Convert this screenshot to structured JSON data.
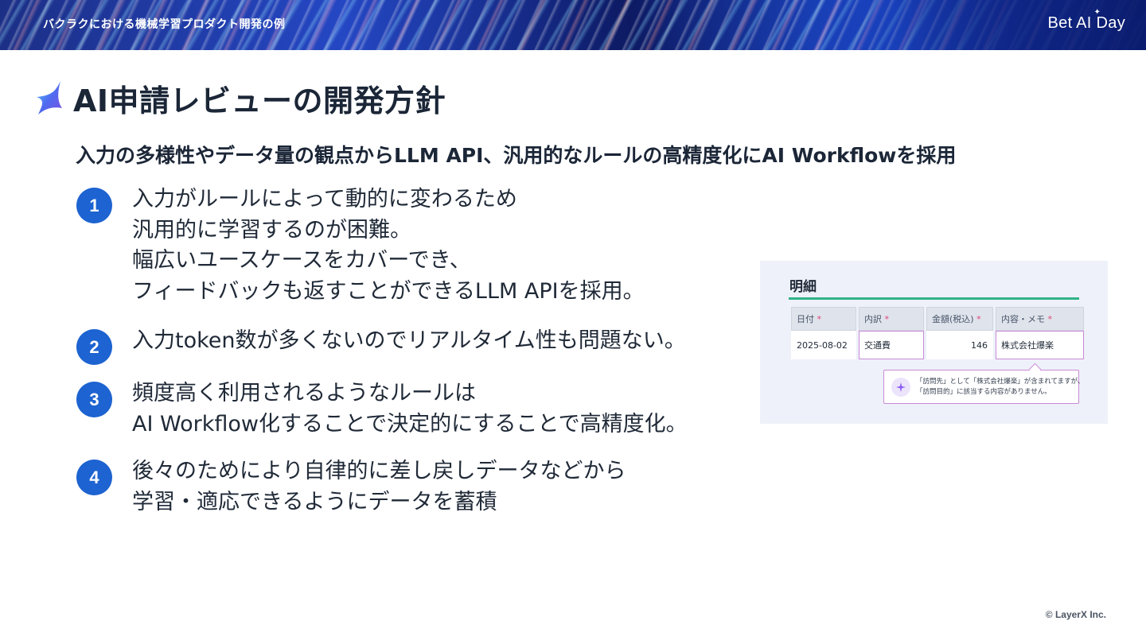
{
  "header": {
    "breadcrumb": "バクラクにおける機械学習プロダクト開発の例",
    "brand": "Bet AI Day"
  },
  "slide": {
    "title": "AI申請レビューの開発方針",
    "subtitle": "入力の多様性やデータ量の観点からLLM API、汎用的なルールの高精度化にAI Workflowを採用",
    "items": [
      {
        "number": "1",
        "lines": [
          "入力がルールによって動的に変わるため",
          "汎用的に学習するのが困難。",
          "幅広いユースケースをカバーでき、",
          "フィードバックも返すことができるLLM APIを採用。"
        ]
      },
      {
        "number": "2",
        "lines": [
          "入力token数が多くないのでリアルタイム性も問題ない。"
        ]
      },
      {
        "number": "3",
        "lines": [
          "頻度高く利用されるようなルールは",
          "AI Workflow化することで決定的にすることで高精度化。"
        ]
      },
      {
        "number": "4",
        "lines": [
          "後々のためにより自律的に差し戻しデータなどから",
          "学習・適応できるようにデータを蓄積"
        ]
      }
    ]
  },
  "mock": {
    "section_title": "明細",
    "columns": [
      {
        "label": "日付",
        "required": "*"
      },
      {
        "label": "内訳",
        "required": "*"
      },
      {
        "label": "金額(税込)",
        "required": "*"
      },
      {
        "label": "内容・メモ",
        "required": "*"
      }
    ],
    "row": {
      "date": "2025-08-02",
      "category": "交通費",
      "amount": "146",
      "memo": "株式会社爆楽"
    },
    "ai_feedback": {
      "line1": "「訪問先」として「株式会社爆楽」が含まれてますが、",
      "line2": "「訪問目的」に該当する内容がありません。"
    }
  },
  "footer": {
    "copyright": "© LayerX Inc."
  },
  "colors": {
    "accent_blue": "#1d63d1",
    "rule_green": "#2fb38a",
    "highlight_purple": "#c98ad6",
    "required_pink": "#e0457b"
  }
}
